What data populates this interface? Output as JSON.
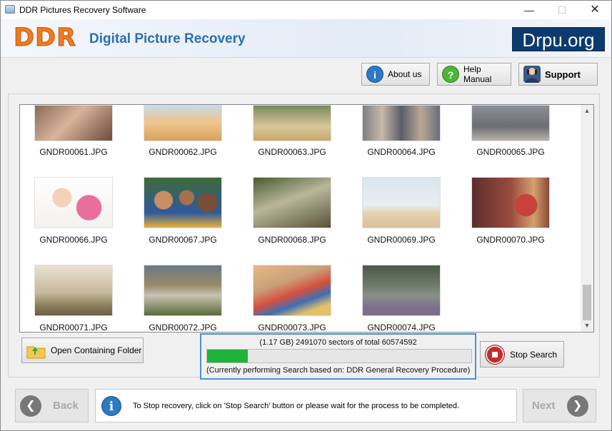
{
  "window": {
    "title": "DDR Pictures Recovery Software",
    "minimize": "—",
    "maximize": "☐",
    "close": "✕"
  },
  "header": {
    "logo": "DDR",
    "app_name": "Digital Picture Recovery",
    "brand": "Drpu.org"
  },
  "toolbar": {
    "about": "About us",
    "help": "Help Manual",
    "support": "Support"
  },
  "gallery": {
    "items": [
      {
        "name": "GNDR00061.JPG"
      },
      {
        "name": "GNDR00062.JPG"
      },
      {
        "name": "GNDR00063.JPG"
      },
      {
        "name": "GNDR00064.JPG"
      },
      {
        "name": "GNDR00065.JPG"
      },
      {
        "name": "GNDR00066.JPG"
      },
      {
        "name": "GNDR00067.JPG"
      },
      {
        "name": "GNDR00068.JPG"
      },
      {
        "name": "GNDR00069.JPG"
      },
      {
        "name": "GNDR00070.JPG"
      },
      {
        "name": "GNDR00071.JPG"
      },
      {
        "name": "GNDR00072.JPG"
      },
      {
        "name": "GNDR00073.JPG"
      },
      {
        "name": "GNDR00074.JPG"
      }
    ]
  },
  "actions": {
    "open_folder": "Open Containing Folder",
    "stop_search": "Stop Search"
  },
  "progress": {
    "text": "(1.17 GB) 2491070   sectors  of  total 60574592",
    "percent": 15.4,
    "status": "(Currently performing Search based on:  DDR General Recovery Procedure)",
    "color": "#1fb33b"
  },
  "footer": {
    "back": "Back",
    "next": "Next",
    "info": "To Stop recovery, click on 'Stop Search' button or please wait for the process to be completed."
  },
  "colors": {
    "accent": "#2b6fb3",
    "logo": "#f07a1e",
    "brand_bg": "#0c3a6e"
  }
}
